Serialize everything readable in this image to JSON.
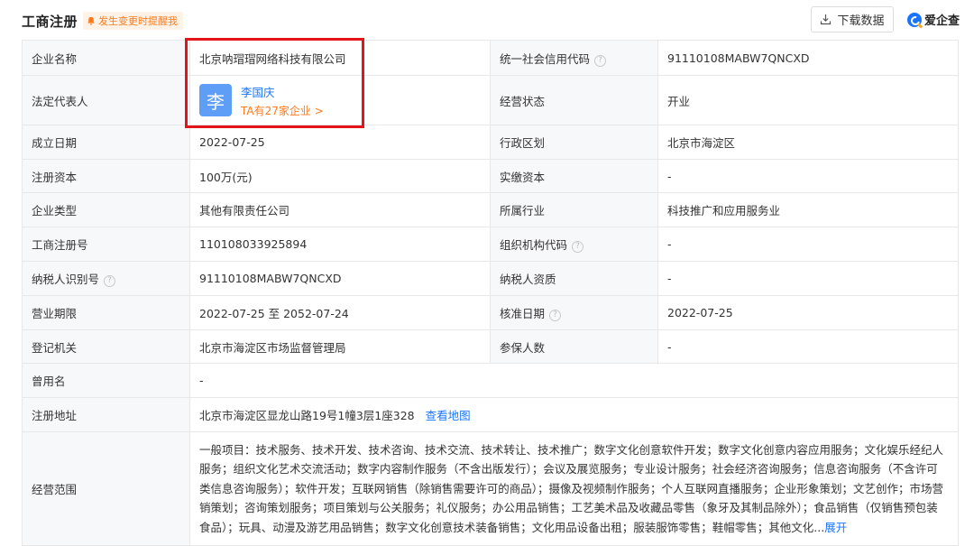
{
  "header": {
    "title": "工商注册",
    "alert_label": "发生变更时提醒我",
    "download_label": "下载数据",
    "brand": "爱企查"
  },
  "rows": [
    {
      "l1": "企业名称",
      "v1": "北京呐瑁瑁网络科技有限公司",
      "l2": "统一社会信用代码",
      "v2": "91110108MABW7QNCXD"
    },
    {
      "l1": "法定代表人",
      "l2": "经营状态",
      "v2": "开业"
    },
    {
      "l1": "成立日期",
      "v1": "2022-07-25",
      "l2": "行政区划",
      "v2": "北京市海淀区"
    },
    {
      "l1": "注册资本",
      "v1": "100万(元)",
      "l2": "实缴资本",
      "v2": "-"
    },
    {
      "l1": "企业类型",
      "v1": "其他有限责任公司",
      "l2": "所属行业",
      "v2": "科技推广和应用服务业"
    },
    {
      "l1": "工商注册号",
      "v1": "110108033925894",
      "l2": "组织机构代码",
      "v2": "-"
    },
    {
      "l1": "纳税人识别号",
      "v1": "91110108MABW7QNCXD",
      "l2": "纳税人资质",
      "v2": "-"
    },
    {
      "l1": "营业期限",
      "v1": "2022-07-25 至 2052-07-24",
      "l2": "核准日期",
      "v2": "2022-07-25"
    },
    {
      "l1": "登记机关",
      "v1": "北京市海淀区市场监督管理局",
      "l2": "参保人数",
      "v2": "-"
    }
  ],
  "legal_rep": {
    "avatar_char": "李",
    "name": "李国庆",
    "companies_link": "TA有27家企业 >"
  },
  "former_name": {
    "label": "曾用名",
    "value": "-"
  },
  "address": {
    "label": "注册地址",
    "value": "北京市海淀区显龙山路19号1幢3层1座328",
    "map_link": "查看地图"
  },
  "scope": {
    "label": "经营范围",
    "text": "一般项目：技术服务、技术开发、技术咨询、技术交流、技术转让、技术推广；数字文化创意软件开发；数字文化创意内容应用服务；文化娱乐经纪人服务；组织文化艺术交流活动；数字内容制作服务（不含出版发行）；会议及展览服务；专业设计服务；社会经济咨询服务；信息咨询服务（不含许可类信息咨询服务）；软件开发；互联网销售（除销售需要许可的商品）；摄像及视频制作服务；个人互联网直播服务；企业形象策划；文艺创作；市场营销策划；咨询策划服务；项目策划与公关服务；礼仪服务；办公用品销售；工艺美术品及收藏品零售（象牙及其制品除外）；食品销售（仅销售预包装食品）；玩具、动漫及游艺用品销售；数字文化创意技术装备销售；文化用品设备出租；服装服饰零售；鞋帽零售；其他文化",
    "ellipsis": "...",
    "expand_label": "展开"
  },
  "help_icon_char": "?"
}
